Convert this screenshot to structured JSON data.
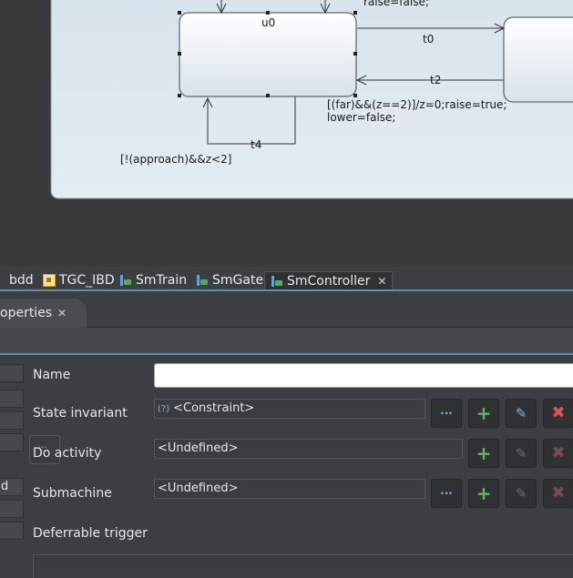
{
  "diagram": {
    "state_name": "u0",
    "transitions": {
      "t0": "t0",
      "t2": "t2",
      "t4": "t4"
    },
    "guard_t2_line1": "[(far)&&(z==2)]/z=0;raise=true;",
    "guard_t2_line2": "lower=false;",
    "guard_t4": "[!(approach)&&z<2]",
    "top_label": "raise=false;"
  },
  "editor_tabs": [
    {
      "label": "bdd",
      "icon": "bdd-icon"
    },
    {
      "label": "TGC_IBD",
      "icon": "ibd-icon"
    },
    {
      "label": "SmTrain",
      "icon": "state-machine-icon"
    },
    {
      "label": "SmGate",
      "icon": "state-machine-icon"
    },
    {
      "label": "SmController",
      "icon": "state-machine-icon",
      "active": true
    }
  ],
  "view_tab": {
    "label": "operties"
  },
  "side_tabs": [
    "",
    "",
    "",
    "",
    "d",
    "",
    ""
  ],
  "properties": {
    "name_label": "Name",
    "name_value": "",
    "state_invariant_label": "State invariant",
    "state_invariant_value": "<Constraint>",
    "do_activity_label": "Do activity",
    "do_activity_value": "<Undefined>",
    "submachine_label": "Submachine",
    "submachine_value": "<Undefined>",
    "deferrable_trigger_label": "Deferrable trigger",
    "constraint_icon": "(?)"
  },
  "colors": {
    "add": "#5cb85c",
    "delete": "#d9534f",
    "accent": "#5c8fb0"
  }
}
